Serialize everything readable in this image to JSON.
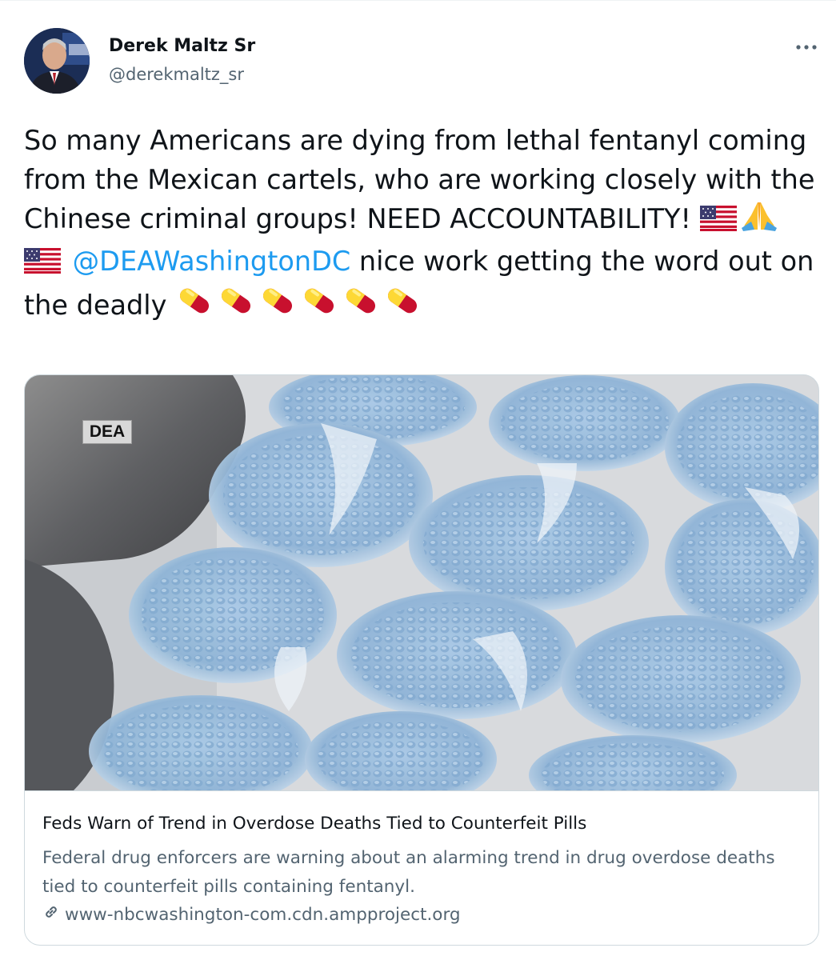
{
  "author": {
    "display_name": "Derek Maltz Sr",
    "handle": "@derekmaltz_sr"
  },
  "tweet": {
    "text_part1": "So many Americans are dying from lethal fentanyl coming from the Mexican cartels, who are working closely with the Chinese criminal groups! NEED ACCOUNTABILITY!",
    "mention": "@DEAWashingtonDC",
    "text_part2": "nice work getting the word out on the deadly",
    "emoji_flag": "us-flag-icon",
    "emoji_hands": "folded-hands-icon",
    "emoji_pill": "pill-icon",
    "pill_count": 6
  },
  "card": {
    "image_tag": "DEA",
    "title": "Feds Warn of Trend in Overdose Deaths Tied to Counterfeit Pills",
    "description": "Federal drug enforcers are warning about an alarming trend in drug overdose deaths tied to counterfeit pills containing fentanyl.",
    "domain": "www-nbcwashington-com.cdn.ampproject.org"
  },
  "colors": {
    "link_blue": "#1d9bf0",
    "secondary_text": "#536471",
    "primary_text": "#0f1419",
    "border": "#cfd9de"
  }
}
